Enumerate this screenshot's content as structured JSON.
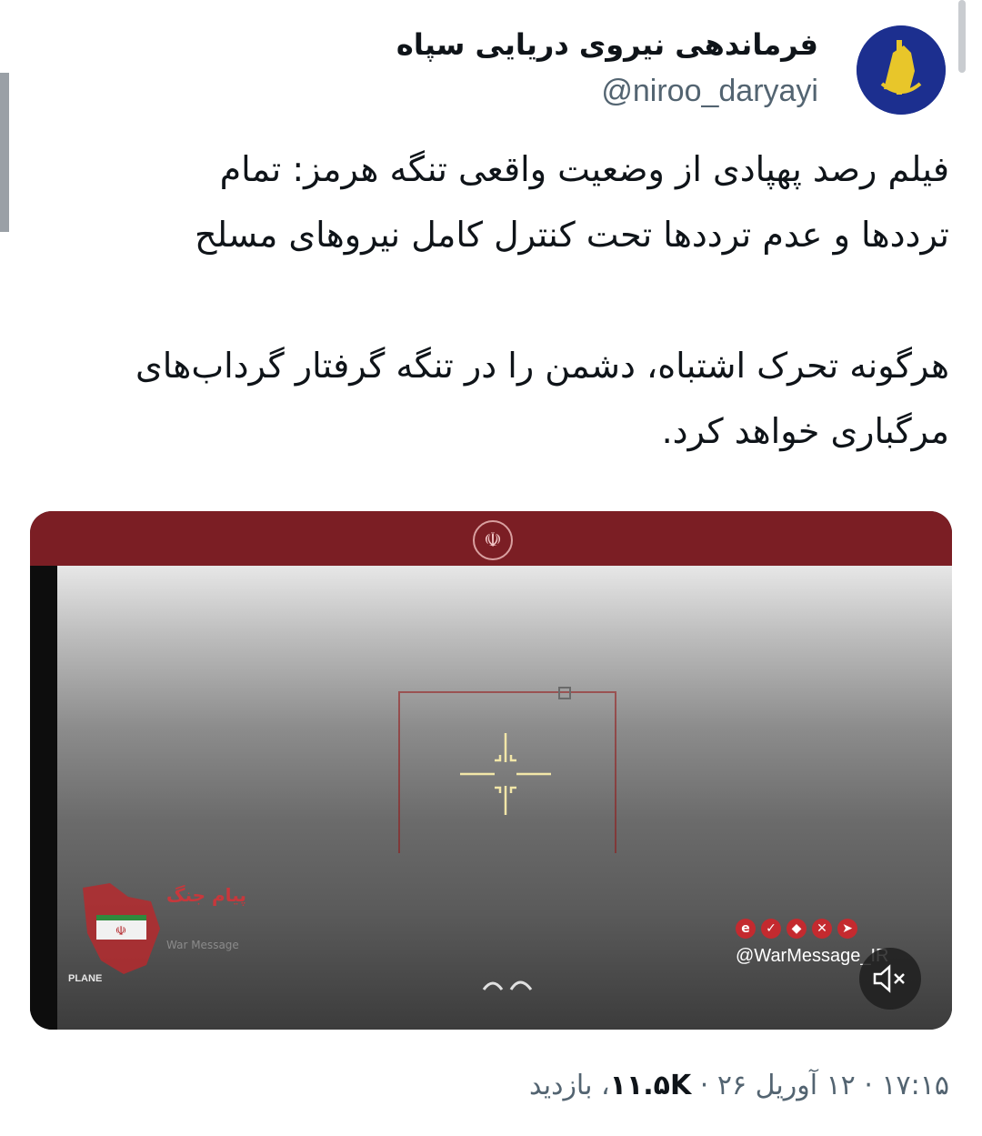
{
  "account": {
    "display_name": "فرماندهی نیروی دریایی سپاه",
    "handle": "@niroo_daryayi",
    "avatar_icon": "irgc-emblem-icon"
  },
  "tweet": {
    "text": "فیلم رصد پهپادی از وضعیت واقعی تنگه هرمز: تمام\nترددها و عدم ترددها تحت کنترل کامل نیروهای مسلح\n\nهرگونه تحرک اشتباه، دشمن را در تنگه گرفتار گرداب‌های\nمرگباری خواهد کرد."
  },
  "media": {
    "top_emblem": "☫",
    "watermark_title": "پیام جنگ",
    "watermark_subtitle": "War Message",
    "social_handle": "@WarMessage_IR",
    "plane_label": "PLANE",
    "colors": {
      "banner": "#7b1e24",
      "accent_red": "#c42a2f",
      "crosshair": "#f2e6a8"
    }
  },
  "meta": {
    "time": "۱۷:۱۵",
    "date": "۱۲ آوریل ۲۶",
    "views_count": "۱۱.۵K",
    "views_label": "بازدید",
    "separator": "·"
  }
}
